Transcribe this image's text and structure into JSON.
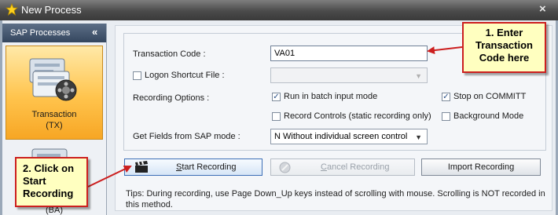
{
  "window": {
    "title": "New Process",
    "close_glyph": "×",
    "star_icon": "star-icon"
  },
  "sidebar": {
    "header": "SAP Processes",
    "collapse_glyph": "«",
    "items": [
      {
        "line1": "Transaction",
        "line2": "(TX)",
        "selected": true
      },
      {
        "line1": "",
        "line2": "(BA)",
        "selected": false
      }
    ]
  },
  "form": {
    "transaction_code": {
      "label": "Transaction Code :",
      "value": "VA01"
    },
    "logon_shortcut": {
      "label": "Logon Shortcut File :",
      "checked": false,
      "value": ""
    },
    "recording_options": {
      "label": "Recording Options :",
      "run_batch": {
        "label": "Run in batch input mode",
        "checked": true
      },
      "record_controls": {
        "label": "Record Controls (static recording only)",
        "checked": false
      },
      "stop_on_commit": {
        "label": "Stop on COMMITT",
        "checked": true
      },
      "background_mode": {
        "label": "Background Mode",
        "checked": false
      }
    },
    "get_fields": {
      "label": "Get Fields from SAP mode :",
      "value": "N Without individual screen control"
    }
  },
  "buttons": {
    "start": {
      "prefix": "S",
      "rest": "tart Recording"
    },
    "cancel": {
      "prefix": "C",
      "rest": "ancel Recording"
    },
    "import": {
      "label": "Import Recording"
    }
  },
  "tips": "Tips: During recording, use Page Down_Up keys instead of scrolling with mouse. Scrolling is NOT recorded in this method.",
  "callouts": {
    "one": [
      "1. Enter",
      "Transaction",
      "Code here"
    ],
    "two": [
      "2. Click on",
      "Start",
      "Recording"
    ]
  },
  "colors": {
    "accent_red": "#cc1f1f",
    "callout_bg": "#ffffc0",
    "selected_item": "#ffc44d"
  }
}
